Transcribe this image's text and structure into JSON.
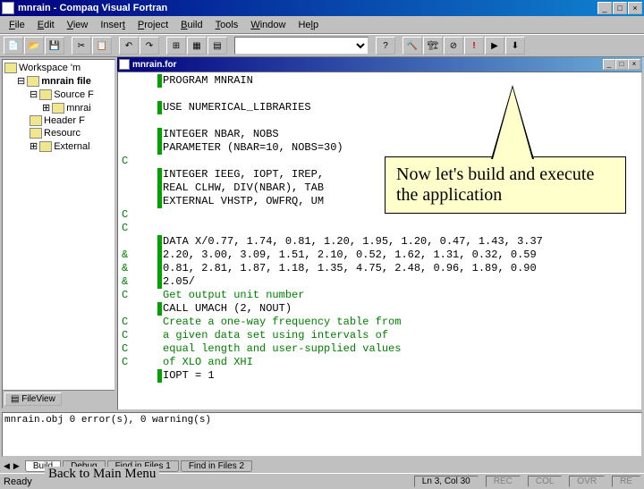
{
  "window": {
    "title": "mnrain - Compaq Visual Fortran"
  },
  "menu": [
    "File",
    "Edit",
    "View",
    "Insert",
    "Project",
    "Build",
    "Tools",
    "Window",
    "Help"
  ],
  "menuUnderline": [
    "F",
    "E",
    "V",
    "I",
    "P",
    "B",
    "T",
    "W",
    "H"
  ],
  "tree": {
    "workspace": "Workspace 'm",
    "project": "mnrain file",
    "items": [
      "Source F",
      "mnrai",
      "Header F",
      "Resourc",
      "External"
    ]
  },
  "leftTab": "FileView",
  "doc": {
    "title": "mnrain.for"
  },
  "code": [
    {
      "bar": true,
      "text": "PROGRAM MNRAIN",
      "pre": ""
    },
    {
      "bar": false,
      "text": "",
      "pre": ""
    },
    {
      "bar": true,
      "text": "USE NUMERICAL_LIBRARIES",
      "pre": ""
    },
    {
      "bar": false,
      "text": "",
      "pre": ""
    },
    {
      "bar": true,
      "text": "INTEGER NBAR, NOBS",
      "pre": ""
    },
    {
      "bar": true,
      "text": "PARAMETER (NBAR=10, NOBS=30)",
      "pre": ""
    },
    {
      "bar": false,
      "text": "",
      "pre": "C"
    },
    {
      "bar": true,
      "text": "INTEGER IEEG, IOPT, IREP,",
      "pre": ""
    },
    {
      "bar": true,
      "text": "REAL CLHW, DIV(NBAR), TAB",
      "pre": ""
    },
    {
      "bar": true,
      "text": "EXTERNAL VHSTP, OWFRQ, UM",
      "pre": ""
    },
    {
      "bar": false,
      "text": "",
      "pre": "C"
    },
    {
      "bar": false,
      "text": "",
      "pre": "C"
    },
    {
      "bar": true,
      "text": "DATA X/0.77, 1.74, 0.81, 1.20, 1.95, 1.20, 0.47, 1.43, 3.37",
      "pre": ""
    },
    {
      "bar": true,
      "text": "2.20, 3.00, 3.09, 1.51, 2.10, 0.52, 1.62, 1.31, 0.32, 0.59",
      "pre": "&"
    },
    {
      "bar": true,
      "text": "0.81, 2.81, 1.87, 1.18, 1.35, 4.75, 2.48, 0.96, 1.89, 0.90",
      "pre": "&"
    },
    {
      "bar": true,
      "text": "2.05/",
      "pre": "&"
    },
    {
      "bar": false,
      "text": "Get output unit number",
      "pre": "C"
    },
    {
      "bar": true,
      "text": "CALL UMACH (2, NOUT)",
      "pre": ""
    },
    {
      "bar": false,
      "text": "Create a one-way frequency table from",
      "pre": "C"
    },
    {
      "bar": false,
      "text": "a given data set using intervals of",
      "pre": "C"
    },
    {
      "bar": false,
      "text": "equal length and user-supplied values",
      "pre": "C"
    },
    {
      "bar": false,
      "text": "of XLO and XHI",
      "pre": "C"
    },
    {
      "bar": true,
      "text": "IOPT = 1",
      "pre": ""
    }
  ],
  "output": "mnrain.obj    0 error(s), 0 warning(s)",
  "bottomTabs": [
    "Build",
    "Debug",
    "Find in Files 1",
    "Find in Files 2"
  ],
  "status": {
    "ready": "Ready",
    "pos": "Ln 3, Col 30",
    "cells": [
      "REC",
      "COL",
      "OVR",
      "RE"
    ]
  },
  "callout": "Now let's build and execute the application",
  "backlink": "Back to Main Menu"
}
